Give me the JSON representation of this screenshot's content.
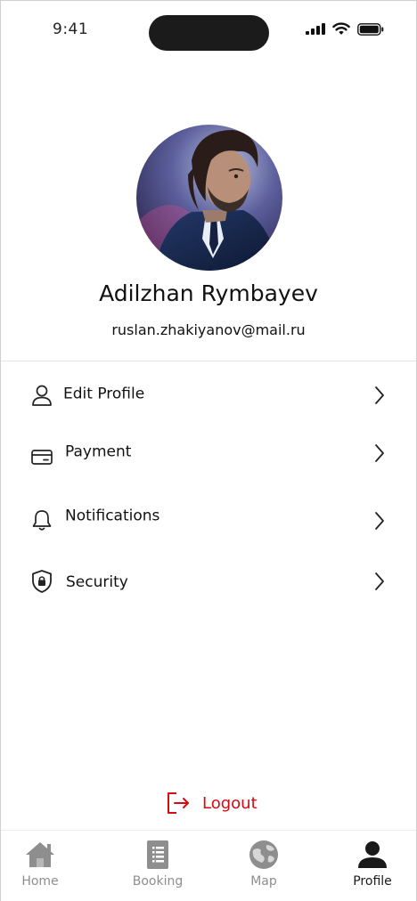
{
  "status_bar": {
    "time": "9:41"
  },
  "profile": {
    "name": "Adilzhan Rymbayev",
    "email": "ruslan.zhakiyanov@mail.ru"
  },
  "menu": {
    "items": [
      {
        "label": "Edit Profile",
        "icon": "user-icon"
      },
      {
        "label": "Payment",
        "icon": "card-icon"
      },
      {
        "label": "Notifications",
        "icon": "bell-icon"
      },
      {
        "label": "Security",
        "icon": "shield-lock-icon"
      }
    ]
  },
  "logout": {
    "label": "Logout",
    "color": "#d60a10"
  },
  "tabbar": {
    "tabs": [
      {
        "label": "Home",
        "icon": "home-icon",
        "active": false
      },
      {
        "label": "Booking",
        "icon": "booking-icon",
        "active": false
      },
      {
        "label": "Map",
        "icon": "globe-icon",
        "active": false
      },
      {
        "label": "Profile",
        "icon": "person-icon",
        "active": true
      }
    ],
    "active_color": "#1a1a1a",
    "inactive_color": "#8e8e8e"
  }
}
